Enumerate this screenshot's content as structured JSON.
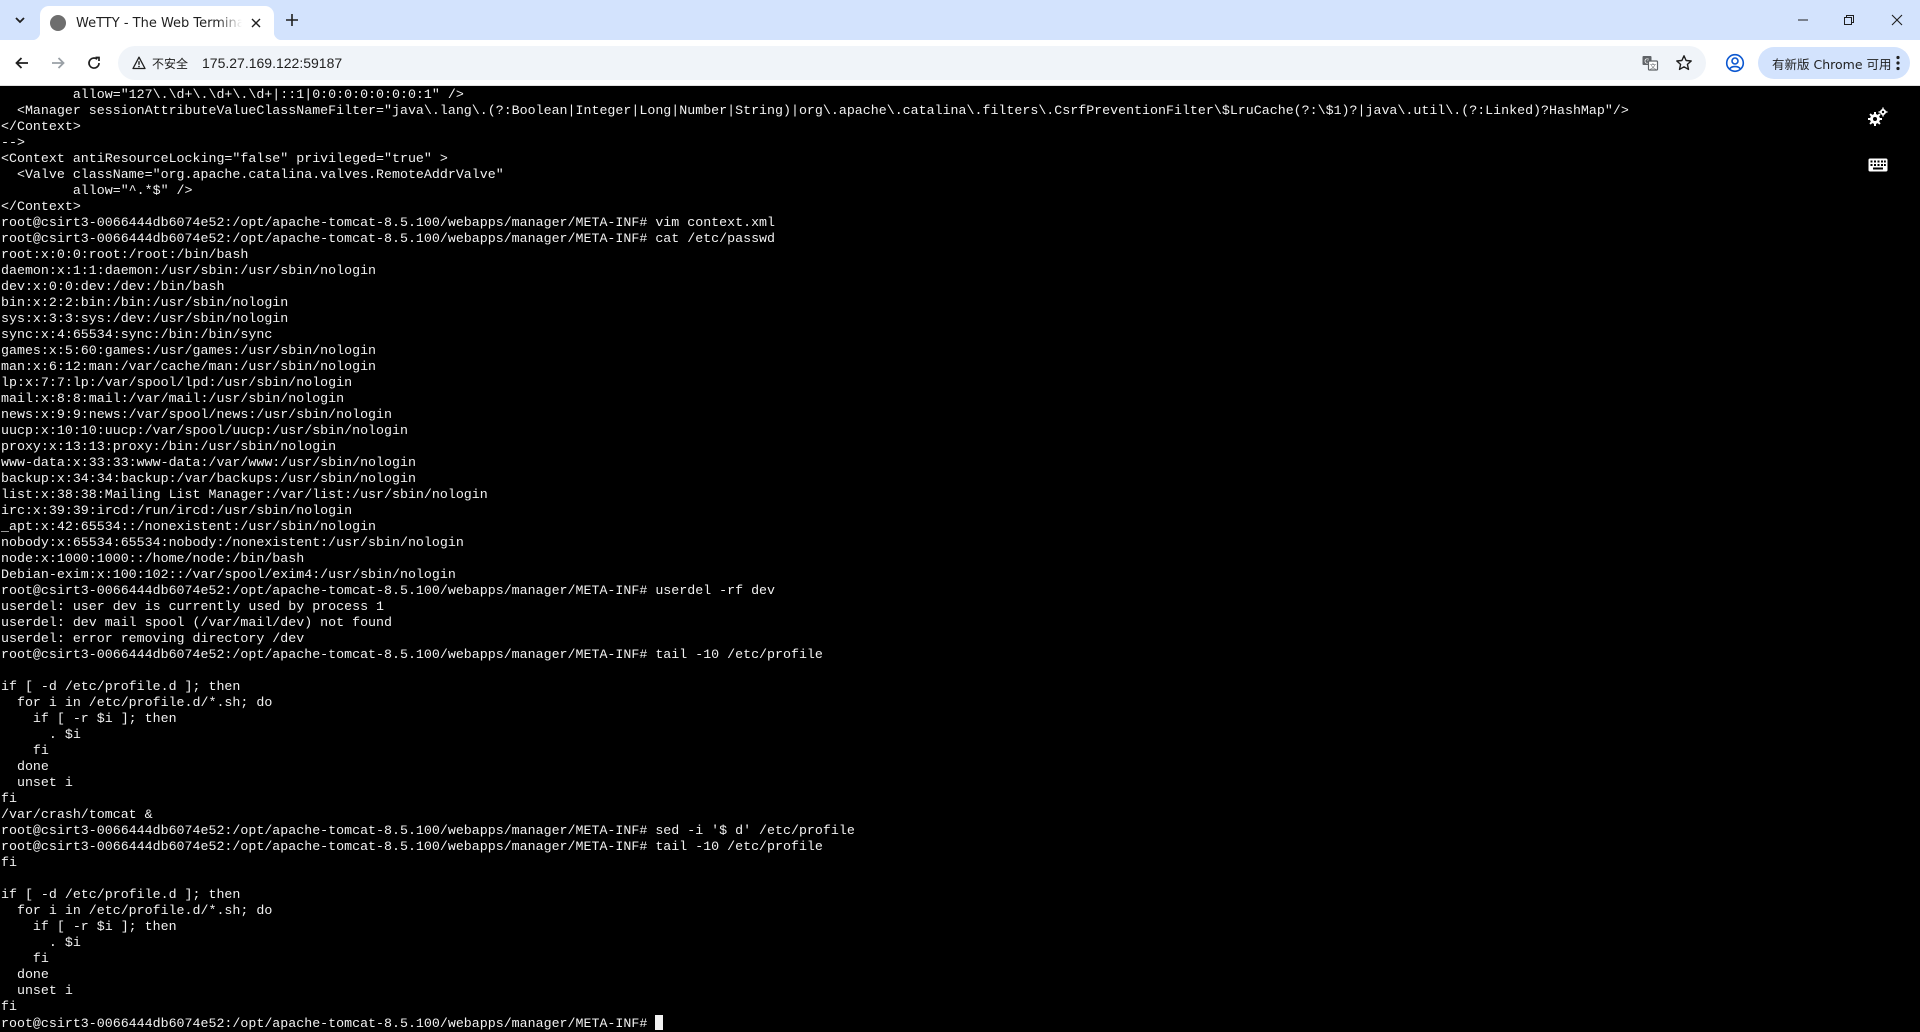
{
  "browser": {
    "tab_title": "WeTTY - The Web Terminal Emulator",
    "security_label": "不安全",
    "url": "175.27.169.122:59187",
    "update_label": "有新版 Chrome 可用"
  },
  "icons": {
    "tab_search": "chevron-down-icon",
    "favicon": "globe-icon",
    "tab_close": "close-icon",
    "new_tab": "plus-icon",
    "back": "arrow-left-icon",
    "forward": "arrow-right-icon",
    "reload": "reload-icon",
    "warning": "warning-icon",
    "translate": "translate-icon",
    "bookmark": "star-icon",
    "profile": "profile-icon",
    "menu": "kebab-icon",
    "settings": "gears-icon",
    "keyboard": "keyboard-icon"
  },
  "terminal": {
    "lines": [
      "         allow=\"127\\.\\d+\\.\\d+\\.\\d+|::1|0:0:0:0:0:0:0:1\" />",
      "  <Manager sessionAttributeValueClassNameFilter=\"java\\.lang\\.(?:Boolean|Integer|Long|Number|String)|org\\.apache\\.catalina\\.filters\\.CsrfPreventionFilter\\$LruCache(?:\\$1)?|java\\.util\\.(?:Linked)?HashMap\"/>",
      "</Context>",
      "-->",
      "<Context antiResourceLocking=\"false\" privileged=\"true\" >",
      "  <Valve className=\"org.apache.catalina.valves.RemoteAddrValve\"",
      "         allow=\"^.*$\" />",
      "</Context>",
      "root@csirt3-0066444db6074e52:/opt/apache-tomcat-8.5.100/webapps/manager/META-INF# vim context.xml",
      "root@csirt3-0066444db6074e52:/opt/apache-tomcat-8.5.100/webapps/manager/META-INF# cat /etc/passwd",
      "root:x:0:0:root:/root:/bin/bash",
      "daemon:x:1:1:daemon:/usr/sbin:/usr/sbin/nologin",
      "dev:x:0:0:dev:/dev:/bin/bash",
      "bin:x:2:2:bin:/bin:/usr/sbin/nologin",
      "sys:x:3:3:sys:/dev:/usr/sbin/nologin",
      "sync:x:4:65534:sync:/bin:/bin/sync",
      "games:x:5:60:games:/usr/games:/usr/sbin/nologin",
      "man:x:6:12:man:/var/cache/man:/usr/sbin/nologin",
      "lp:x:7:7:lp:/var/spool/lpd:/usr/sbin/nologin",
      "mail:x:8:8:mail:/var/mail:/usr/sbin/nologin",
      "news:x:9:9:news:/var/spool/news:/usr/sbin/nologin",
      "uucp:x:10:10:uucp:/var/spool/uucp:/usr/sbin/nologin",
      "proxy:x:13:13:proxy:/bin:/usr/sbin/nologin",
      "www-data:x:33:33:www-data:/var/www:/usr/sbin/nologin",
      "backup:x:34:34:backup:/var/backups:/usr/sbin/nologin",
      "list:x:38:38:Mailing List Manager:/var/list:/usr/sbin/nologin",
      "irc:x:39:39:ircd:/run/ircd:/usr/sbin/nologin",
      "_apt:x:42:65534::/nonexistent:/usr/sbin/nologin",
      "nobody:x:65534:65534:nobody:/nonexistent:/usr/sbin/nologin",
      "node:x:1000:1000::/home/node:/bin/bash",
      "Debian-exim:x:100:102::/var/spool/exim4:/usr/sbin/nologin",
      "root@csirt3-0066444db6074e52:/opt/apache-tomcat-8.5.100/webapps/manager/META-INF# userdel -rf dev",
      "userdel: user dev is currently used by process 1",
      "userdel: dev mail spool (/var/mail/dev) not found",
      "userdel: error removing directory /dev",
      "root@csirt3-0066444db6074e52:/opt/apache-tomcat-8.5.100/webapps/manager/META-INF# tail -10 /etc/profile",
      "",
      "if [ -d /etc/profile.d ]; then",
      "  for i in /etc/profile.d/*.sh; do",
      "    if [ -r $i ]; then",
      "      . $i",
      "    fi",
      "  done",
      "  unset i",
      "fi",
      "/var/crash/tomcat &",
      "root@csirt3-0066444db6074e52:/opt/apache-tomcat-8.5.100/webapps/manager/META-INF# sed -i '$ d' /etc/profile",
      "root@csirt3-0066444db6074e52:/opt/apache-tomcat-8.5.100/webapps/manager/META-INF# tail -10 /etc/profile",
      "fi",
      "",
      "if [ -d /etc/profile.d ]; then",
      "  for i in /etc/profile.d/*.sh; do",
      "    if [ -r $i ]; then",
      "      . $i",
      "    fi",
      "  done",
      "  unset i",
      "fi"
    ],
    "prompt": "root@csirt3-0066444db6074e52:/opt/apache-tomcat-8.5.100/webapps/manager/META-INF# "
  }
}
